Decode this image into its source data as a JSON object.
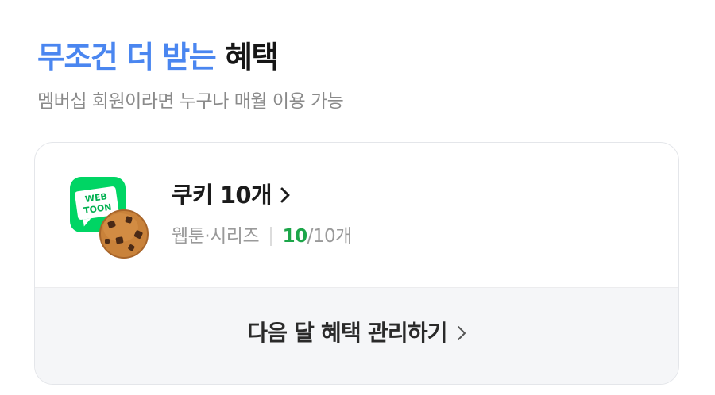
{
  "section": {
    "title_highlight": "무조건 더 받는",
    "title_rest": "혜택",
    "subtitle": "멤버십 회원이라면 누구나 매월 이용 가능"
  },
  "benefit": {
    "icon": "webtoon-app-icon",
    "icon_text_line1": "WEB",
    "icon_text_line2": "TOON",
    "title": "쿠키 10개",
    "service": "웹툰·시리즈",
    "used": "10",
    "total": "/10개"
  },
  "footer": {
    "manage_label": "다음 달 혜택 관리하기"
  },
  "colors": {
    "accent": "#4a86f0",
    "count_green": "#1da64a",
    "webtoon_green": "#00d564"
  }
}
